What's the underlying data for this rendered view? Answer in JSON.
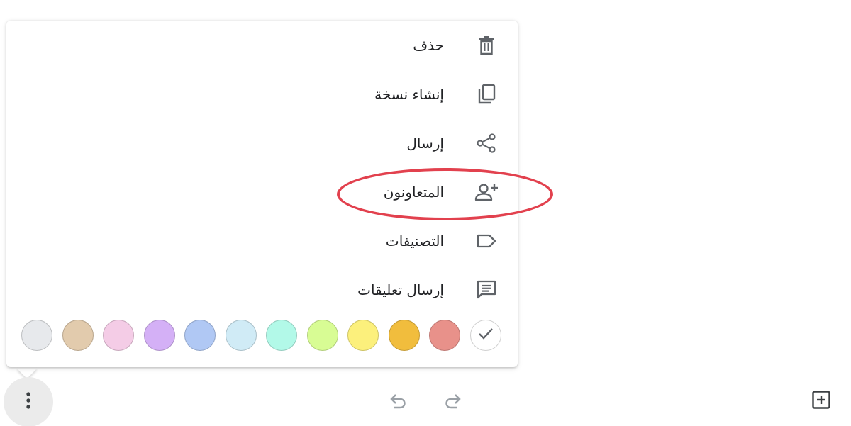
{
  "menu": {
    "items": [
      {
        "label": "حذف",
        "icon": "trash-icon"
      },
      {
        "label": "إنشاء نسخة",
        "icon": "copy-icon"
      },
      {
        "label": "إرسال",
        "icon": "share-icon"
      },
      {
        "label": "المتعاونون",
        "icon": "add-person-icon"
      },
      {
        "label": "التصنيفات",
        "icon": "label-tag-icon"
      },
      {
        "label": "إرسال تعليقات",
        "icon": "feedback-icon"
      }
    ]
  },
  "colors": {
    "selected": "default",
    "swatches": [
      {
        "name": "default",
        "hex": "#ffffff",
        "icon": "check-icon"
      },
      {
        "name": "red",
        "hex": "#e8918a"
      },
      {
        "name": "orange",
        "hex": "#f1bd3d"
      },
      {
        "name": "yellow",
        "hex": "#fcf07c"
      },
      {
        "name": "green",
        "hex": "#d8fc94"
      },
      {
        "name": "teal",
        "hex": "#b2f9e8"
      },
      {
        "name": "light-blue",
        "hex": "#d0ebf6"
      },
      {
        "name": "blue",
        "hex": "#b0c8f4"
      },
      {
        "name": "purple",
        "hex": "#d4b0f6"
      },
      {
        "name": "pink",
        "hex": "#f4cce6"
      },
      {
        "name": "brown",
        "hex": "#e2cbad"
      },
      {
        "name": "gray",
        "hex": "#e7e9ec"
      }
    ]
  },
  "toolbar": {
    "more_icon": "more-vertical-icon",
    "undo_icon": "undo-icon",
    "redo_icon": "redo-icon",
    "add_icon": "add-box-icon"
  },
  "annotation": {
    "highlight_color": "#e2414e",
    "highlighted_item": "المتعاونون"
  }
}
